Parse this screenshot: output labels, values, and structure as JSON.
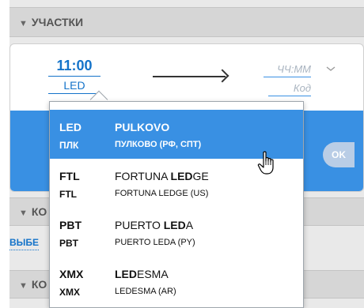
{
  "sections": {
    "segments": "УЧАСТКИ",
    "second": "КО",
    "third": "КО"
  },
  "route": {
    "time": "11:00",
    "code": "LED",
    "time_placeholder": "ЧЧ:ММ",
    "code_placeholder": "Код"
  },
  "ok_label": "OK",
  "select_link": "ВЫБЕ",
  "dropdown": {
    "options": [
      {
        "code": "LED",
        "code_local": "ПЛК",
        "name": "PULKOVO",
        "name_pre": "",
        "name_bold": "",
        "name_post": "",
        "subtitle": "ПУЛКОВО (РФ, СПТ)"
      },
      {
        "code": "FTL",
        "code_local": "FTL",
        "name": "",
        "name_pre": "FORTUNA ",
        "name_bold": "LED",
        "name_post": "GE",
        "subtitle": "FORTUNA LEDGE (US)"
      },
      {
        "code": "PBT",
        "code_local": "PBT",
        "name": "",
        "name_pre": "PUERTO ",
        "name_bold": "LED",
        "name_post": "A",
        "subtitle": "PUERTO LEDA (PY)"
      },
      {
        "code": "XMX",
        "code_local": "XMX",
        "name": "",
        "name_pre": "",
        "name_bold": "LED",
        "name_post": "ESMA",
        "subtitle": "LEDESMA (AR)"
      }
    ]
  },
  "colors": {
    "accent": "#3990e3",
    "link": "#1473c9",
    "header_bg": "#d6d6d6"
  }
}
